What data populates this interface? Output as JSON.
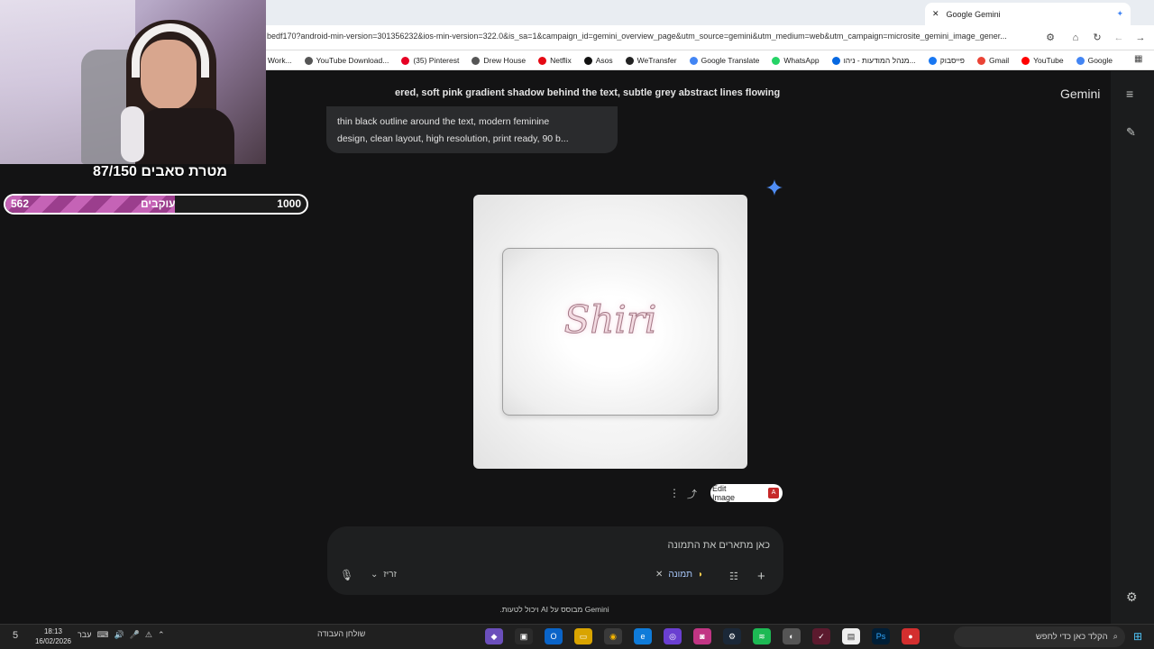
{
  "browser": {
    "tab_title": "Google Gemini",
    "url": "bedf170?android-min-version=301356232&ios-min-version=322.0&is_sa=1&campaign_id=gemini_overview_page&utm_source=gemini&utm_medium=web&utm_campaign=microsite_gemini_image_gener...",
    "bookmarks": [
      "Google",
      "YouTube",
      "Gmail",
      "פייסבוק",
      "מנהל המודעות - ניהו...",
      "WhatsApp",
      "Google Translate",
      "WeTransfer",
      "Asos",
      "Netflix",
      "Drew House",
      "(35) Pinterest",
      "YouTube Download...",
      "עריכה | Shiri's Work..."
    ],
    "bookmark_colors": [
      "#4285f4",
      "#ff0000",
      "#ea4335",
      "#1877f2",
      "#0668e1",
      "#25d366",
      "#4285f4",
      "#222222",
      "#111111",
      "#e50914",
      "#555555",
      "#e60023",
      "#555555",
      "#d33b6b"
    ]
  },
  "gemini": {
    "brand": "Gemini",
    "top_prompt": "ered, soft pink gradient shadow behind the text, subtle grey abstract lines flowing acr",
    "user_message_line1": "thin black outline around the text, modern feminine",
    "user_message_line2": "design, clean layout, high resolution, print ready, 90 b...",
    "image_text": "Shiri",
    "edit_image_label": "Edit Image",
    "input_placeholder": "כאן מתארים את התמונה",
    "chip_label": "תמונה",
    "mode_label": "זריז",
    "disclaimer": "Gemini מבוסס על AI ויכול לטעות.",
    "accent_color": "#a8c7fa"
  },
  "overlay": {
    "goal_title": "מטרת סאבים 87/150",
    "goal_current": "562",
    "goal_label": "עוקבים",
    "goal_target": "1000",
    "goal_fraction": 0.562
  },
  "taskbar": {
    "search_placeholder": "הקלד כאן כדי לחפש",
    "widgets_label": "שולחן העבודה",
    "language": "עבר",
    "time": "18:13",
    "date": "16/02/2026",
    "notifications_count": "5"
  }
}
